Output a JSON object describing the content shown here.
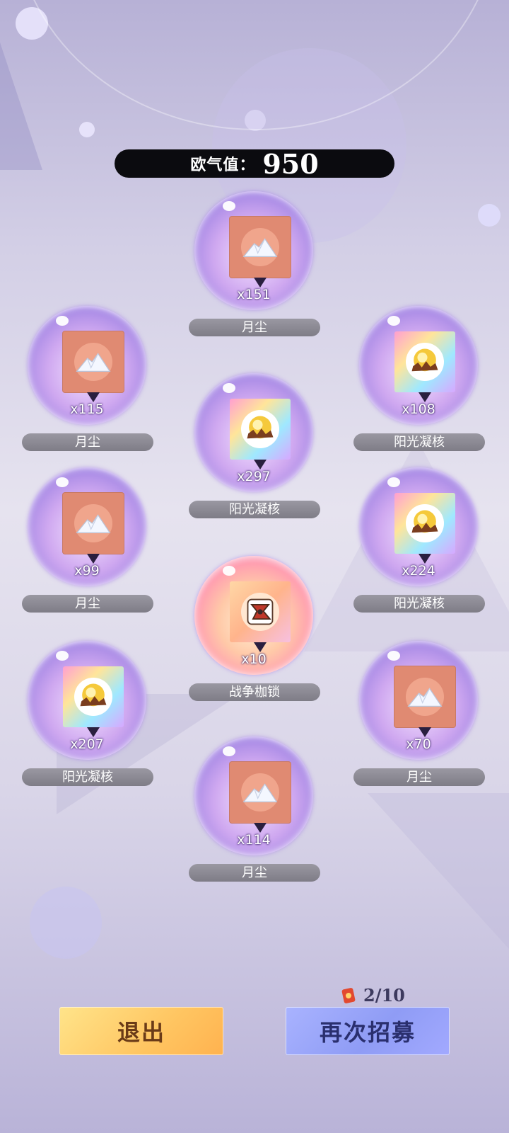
{
  "luck": {
    "label": "欧气值：",
    "value": "950"
  },
  "rewards": [
    {
      "name": "月尘",
      "qty": "x151",
      "kind": "moon-dust"
    },
    {
      "name": "月尘",
      "qty": "x115",
      "kind": "moon-dust"
    },
    {
      "name": "阳光凝核",
      "qty": "x108",
      "kind": "sun-core"
    },
    {
      "name": "阳光凝核",
      "qty": "x297",
      "kind": "sun-core"
    },
    {
      "name": "月尘",
      "qty": "x99",
      "kind": "moon-dust"
    },
    {
      "name": "阳光凝核",
      "qty": "x224",
      "kind": "sun-core"
    },
    {
      "name": "战争枷锁",
      "qty": "x10",
      "kind": "war-shackles"
    },
    {
      "name": "阳光凝核",
      "qty": "x207",
      "kind": "sun-core"
    },
    {
      "name": "月尘",
      "qty": "x70",
      "kind": "moon-dust"
    },
    {
      "name": "月尘",
      "qty": "x114",
      "kind": "moon-dust"
    }
  ],
  "tickets": {
    "count": "2/10",
    "icon": "ticket-icon"
  },
  "buttons": {
    "exit": "退出",
    "again": "再次招募"
  },
  "colors": {
    "exit_button": "#ffc561",
    "again_button": "#8f9cf5",
    "bubble": "#cfa8f0",
    "name_bar": "#8a8892"
  }
}
